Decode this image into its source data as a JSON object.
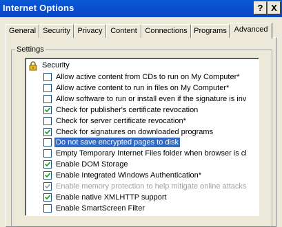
{
  "window": {
    "title": "Internet Options",
    "help_label": "?",
    "close_label": "X"
  },
  "tabs": [
    {
      "label": "General"
    },
    {
      "label": "Security"
    },
    {
      "label": "Privacy"
    },
    {
      "label": "Content"
    },
    {
      "label": "Connections"
    },
    {
      "label": "Programs"
    },
    {
      "label": "Advanced",
      "active": true
    }
  ],
  "settings": {
    "group_label": "Settings",
    "category": "Security",
    "items": [
      {
        "label": "Allow active content from CDs to run on My Computer*",
        "checked": false
      },
      {
        "label": "Allow active content to run in files on My Computer*",
        "checked": false
      },
      {
        "label": "Allow software to run or install even if the signature is inva",
        "checked": false
      },
      {
        "label": "Check for publisher's certificate revocation",
        "checked": true
      },
      {
        "label": "Check for server certificate revocation*",
        "checked": false
      },
      {
        "label": "Check for signatures on downloaded programs",
        "checked": true
      },
      {
        "label": "Do not save encrypted pages to disk",
        "checked": false,
        "selected": true
      },
      {
        "label": "Empty Temporary Internet Files folder when browser is clo",
        "checked": false
      },
      {
        "label": "Enable DOM Storage",
        "checked": true
      },
      {
        "label": "Enable Integrated Windows Authentication*",
        "checked": true
      },
      {
        "label": "Enable memory protection to help mitigate online attacks*",
        "checked": true,
        "disabled": true
      },
      {
        "label": "Enable native XMLHTTP support",
        "checked": true
      },
      {
        "label": "Enable SmartScreen Filter",
        "checked": false
      }
    ]
  },
  "icons": {
    "category": "lock-icon",
    "check": "checkmark-icon"
  },
  "colors": {
    "title_bar": "#0a4fcf",
    "selection": "#316ac5",
    "checkbox_border": "#1c5180",
    "checkmark": "#21a121",
    "disabled_text": "#a0a0a0"
  }
}
